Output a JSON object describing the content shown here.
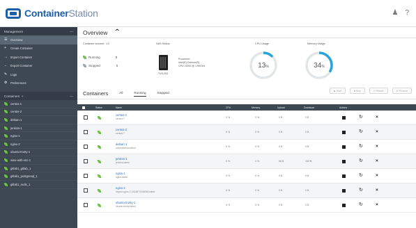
{
  "app": {
    "title_bold": "Container",
    "title_light": "Station",
    "icons": [
      "share-icon",
      "help-icon"
    ],
    "help_label": "?"
  },
  "sidebar": {
    "management_header": "Management",
    "management_items": [
      {
        "label": "Overview",
        "active": true
      },
      {
        "label": "Create Container"
      },
      {
        "label": "Import Container"
      },
      {
        "label": "Export Container"
      },
      {
        "label": "Logs"
      },
      {
        "label": "Preferences"
      }
    ],
    "containers_header": "Containers",
    "containers_add": "+",
    "containers": [
      "centos-1",
      "centos-2",
      "debian-1",
      "jenkins-1",
      "nginx-1",
      "nginx-2",
      "ubuntu-trusty-1",
      "wine-with-vnc-1",
      "gitlab1_gitlab_1",
      "gitlab1_postgresql_1",
      "gitlab1_redis_1"
    ]
  },
  "overview": {
    "title": "Overview",
    "container_amount": "Container amount : 13",
    "running_label": "Running",
    "running_count": "8",
    "stopped_label": "Stopped",
    "stopped_count": "5",
    "nas_label": "NAS Status",
    "nas_model": "TVS-253",
    "processor_label": "Processor:",
    "processor_line1": "Intel(R) Celeron(R)",
    "processor_line2": "CPU J1900 @ 1.99GHz",
    "cpu_label": "CPU Usage",
    "cpu_value": "13",
    "cpu_unit": "%",
    "mem_label": "Memory Usage",
    "mem_value": "34",
    "mem_unit": "%",
    "cpu_fraction": 0.13,
    "mem_fraction": 0.34,
    "gauge_color": "#29a4d6"
  },
  "containers": {
    "title": "Containers",
    "tabs": [
      {
        "label": "All"
      },
      {
        "label": "Running",
        "active": true
      },
      {
        "label": "Stopped"
      }
    ],
    "actions": [
      "Start",
      "Stop",
      "Restart",
      "Remove"
    ],
    "columns": {
      "status": "Status",
      "name": "Name",
      "cpu": "CPU",
      "memory": "Memory",
      "upload": "Upload",
      "download": "Download",
      "actions": "Actions"
    },
    "rows": [
      {
        "name": "centos-1",
        "image": "centos:7",
        "cpu": "0 %",
        "mem": "0 %",
        "up": "0 B",
        "down": "0 B"
      },
      {
        "name": "centos-2",
        "image": "centos:7",
        "cpu": "0 %",
        "mem": "0 %",
        "up": "0 B",
        "down": "0 B"
      },
      {
        "name": "debian-1",
        "image": "tutum/debian:latest",
        "cpu": "0 %",
        "mem": "0 %",
        "up": "0 B",
        "down": "0 B"
      },
      {
        "name": "jenkins-1",
        "image": "jenkins:latest",
        "cpu": "0 %",
        "mem": "0 %",
        "up": "96 B",
        "down": "132 B"
      },
      {
        "name": "nginx-1",
        "image": "nginx:latest",
        "cpu": "0 %",
        "mem": "0 %",
        "up": "0 B",
        "down": "0 B"
      },
      {
        "name": "nginx-2",
        "image": "import:nginx-2-1434872536096:latest",
        "cpu": "0 %",
        "mem": "0 %",
        "up": "0 B",
        "down": "0 B"
      },
      {
        "name": "ubuntu-trusty-1",
        "image": "ubuntu:trusty:latest",
        "cpu": "0 %",
        "mem": "0 %",
        "up": "0 B",
        "down": "0 B"
      }
    ]
  }
}
